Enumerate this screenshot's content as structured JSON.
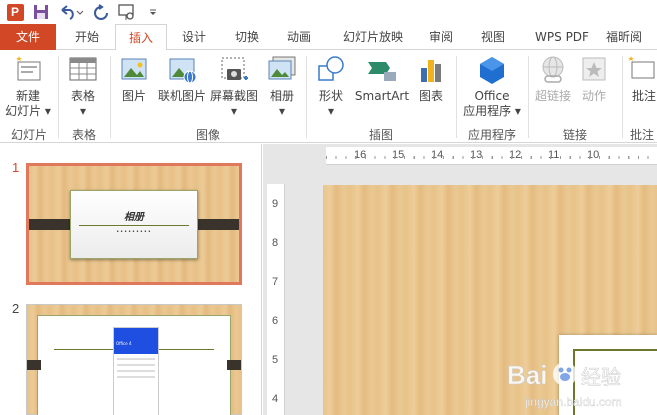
{
  "qat": {
    "app_logo": "P"
  },
  "tabs": [
    {
      "label": "文件"
    },
    {
      "label": "开始"
    },
    {
      "label": "插入"
    },
    {
      "label": "设计"
    },
    {
      "label": "切换"
    },
    {
      "label": "动画"
    },
    {
      "label": "幻灯片放映"
    },
    {
      "label": "审阅"
    },
    {
      "label": "视图"
    },
    {
      "label": "WPS PDF"
    },
    {
      "label": "福昕阅"
    }
  ],
  "ribbon": {
    "new_slide": {
      "line1": "新建",
      "line2": "幻灯片 ▾"
    },
    "table": {
      "label": "表格",
      "arrow": "▾"
    },
    "picture": {
      "label": "图片"
    },
    "online_picture": {
      "label": "联机图片"
    },
    "screenshot": {
      "label": "屏幕截图",
      "arrow": "▾"
    },
    "album": {
      "label": "相册",
      "arrow": "▾"
    },
    "shapes": {
      "label": "形状",
      "arrow": "▾"
    },
    "smartart": {
      "label": "SmartArt"
    },
    "chart": {
      "label": "图表"
    },
    "office_apps": {
      "line1": "Office",
      "line2": "应用程序 ▾"
    },
    "hyperlink": {
      "label": "超链接"
    },
    "action": {
      "label": "动作"
    },
    "comment": {
      "label": "批注"
    },
    "groups": {
      "slides": "幻灯片",
      "tables": "表格",
      "images": "图像",
      "illustrations": "插图",
      "apps": "应用程序",
      "links": "链接",
      "comments": "批注"
    }
  },
  "thumbnails": [
    {
      "number": "1",
      "title": "相册",
      "subtitle": "•••••••••"
    },
    {
      "number": "2",
      "header": "",
      "card_title": "Office 4"
    }
  ],
  "ruler": {
    "horizontal": [
      "16",
      "15",
      "14",
      "13",
      "12",
      "11",
      "10"
    ],
    "vertical": [
      "9",
      "8",
      "7",
      "6",
      "5",
      "4"
    ]
  },
  "watermark": {
    "brand": "Bai",
    "brand_suffix": "经验",
    "url": "jingyan.baidu.com"
  },
  "colors": {
    "accent": "#d24726",
    "selection": "#e0785b",
    "card_blue": "#1e4fe0"
  }
}
